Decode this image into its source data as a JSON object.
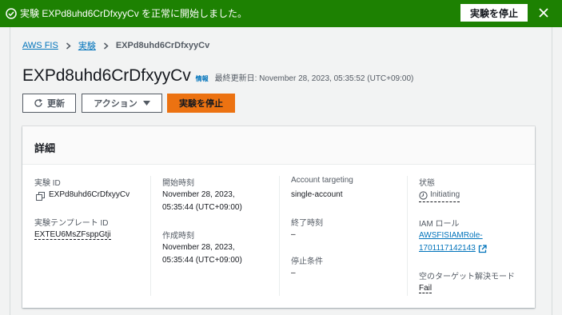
{
  "flash": {
    "message": "実験 EXPd8uhd6CrDfxyyCv を正常に開始しました。",
    "action_label": "実験を停止"
  },
  "breadcrumb": {
    "items": [
      "AWS FIS",
      "実験"
    ],
    "current": "EXPd8uhd6CrDfxyyCv"
  },
  "header": {
    "title": "EXPd8uhd6CrDfxyyCv",
    "info_label": "情報",
    "updated": "最終更新日: November 28, 2023, 05:35:52 (UTC+09:00)"
  },
  "toolbar": {
    "refresh_label": "更新",
    "actions_label": "アクション",
    "stop_label": "実験を停止"
  },
  "details": {
    "title": "詳細",
    "experiment_id_label": "実験 ID",
    "experiment_id": "EXPd8uhd6CrDfxyyCv",
    "template_id_label": "実験テンプレート ID",
    "template_id": "EXTEU6MsZFsppGtji",
    "start_time_label": "開始時刻",
    "start_time_line1": "November 28, 2023,",
    "start_time_line2": "05:35:44 (UTC+09:00)",
    "creation_time_label": "作成時刻",
    "creation_time_line1": "November 28, 2023,",
    "creation_time_line2": "05:35:44 (UTC+09:00)",
    "account_targeting_label": "Account targeting",
    "account_targeting": "single-account",
    "end_time_label": "終了時刻",
    "end_time": "–",
    "stop_conditions_label": "停止条件",
    "stop_conditions": "–",
    "state_label": "状態",
    "state": "Initiating",
    "iam_role_label": "IAM ロール",
    "iam_role_line1": "AWSFISIAMRole-",
    "iam_role_line2": "1701117142143",
    "empty_target_label": "空のターゲット解決モード",
    "empty_target": "Fail"
  },
  "colors": {
    "success": "#1d8102",
    "primary": "#ec7211",
    "link": "#0073bb"
  }
}
